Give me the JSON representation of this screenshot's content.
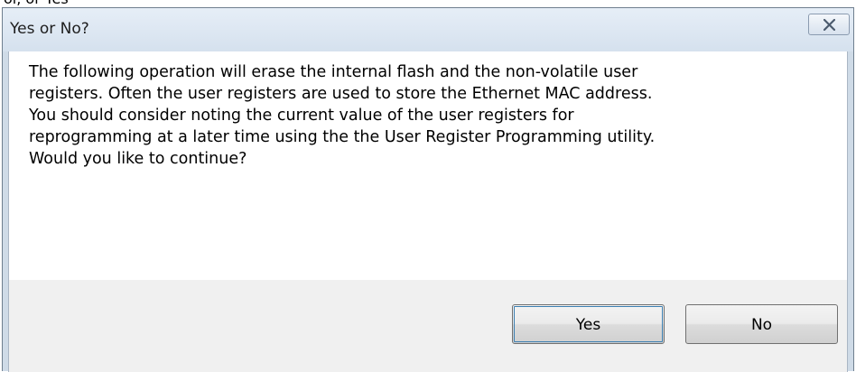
{
  "background_caption": "ol, or Yes",
  "dialog": {
    "title": "Yes or No?",
    "close_icon": "close-icon",
    "message": "The following operation will erase the internal flash and the non-volatile user\nregisters.  Often the user registers are used to store the Ethernet MAC address.\nYou should consider noting the current value of the user registers for\nreprogramming at a later time using the the User Register Programming utility.\nWould you like to continue?",
    "buttons": {
      "yes_label": "Yes",
      "no_label": "No"
    }
  },
  "colors": {
    "titlebar": "#dbe6f2",
    "footer": "#f0f0f0",
    "focus_ring": "#3c7fb1"
  }
}
